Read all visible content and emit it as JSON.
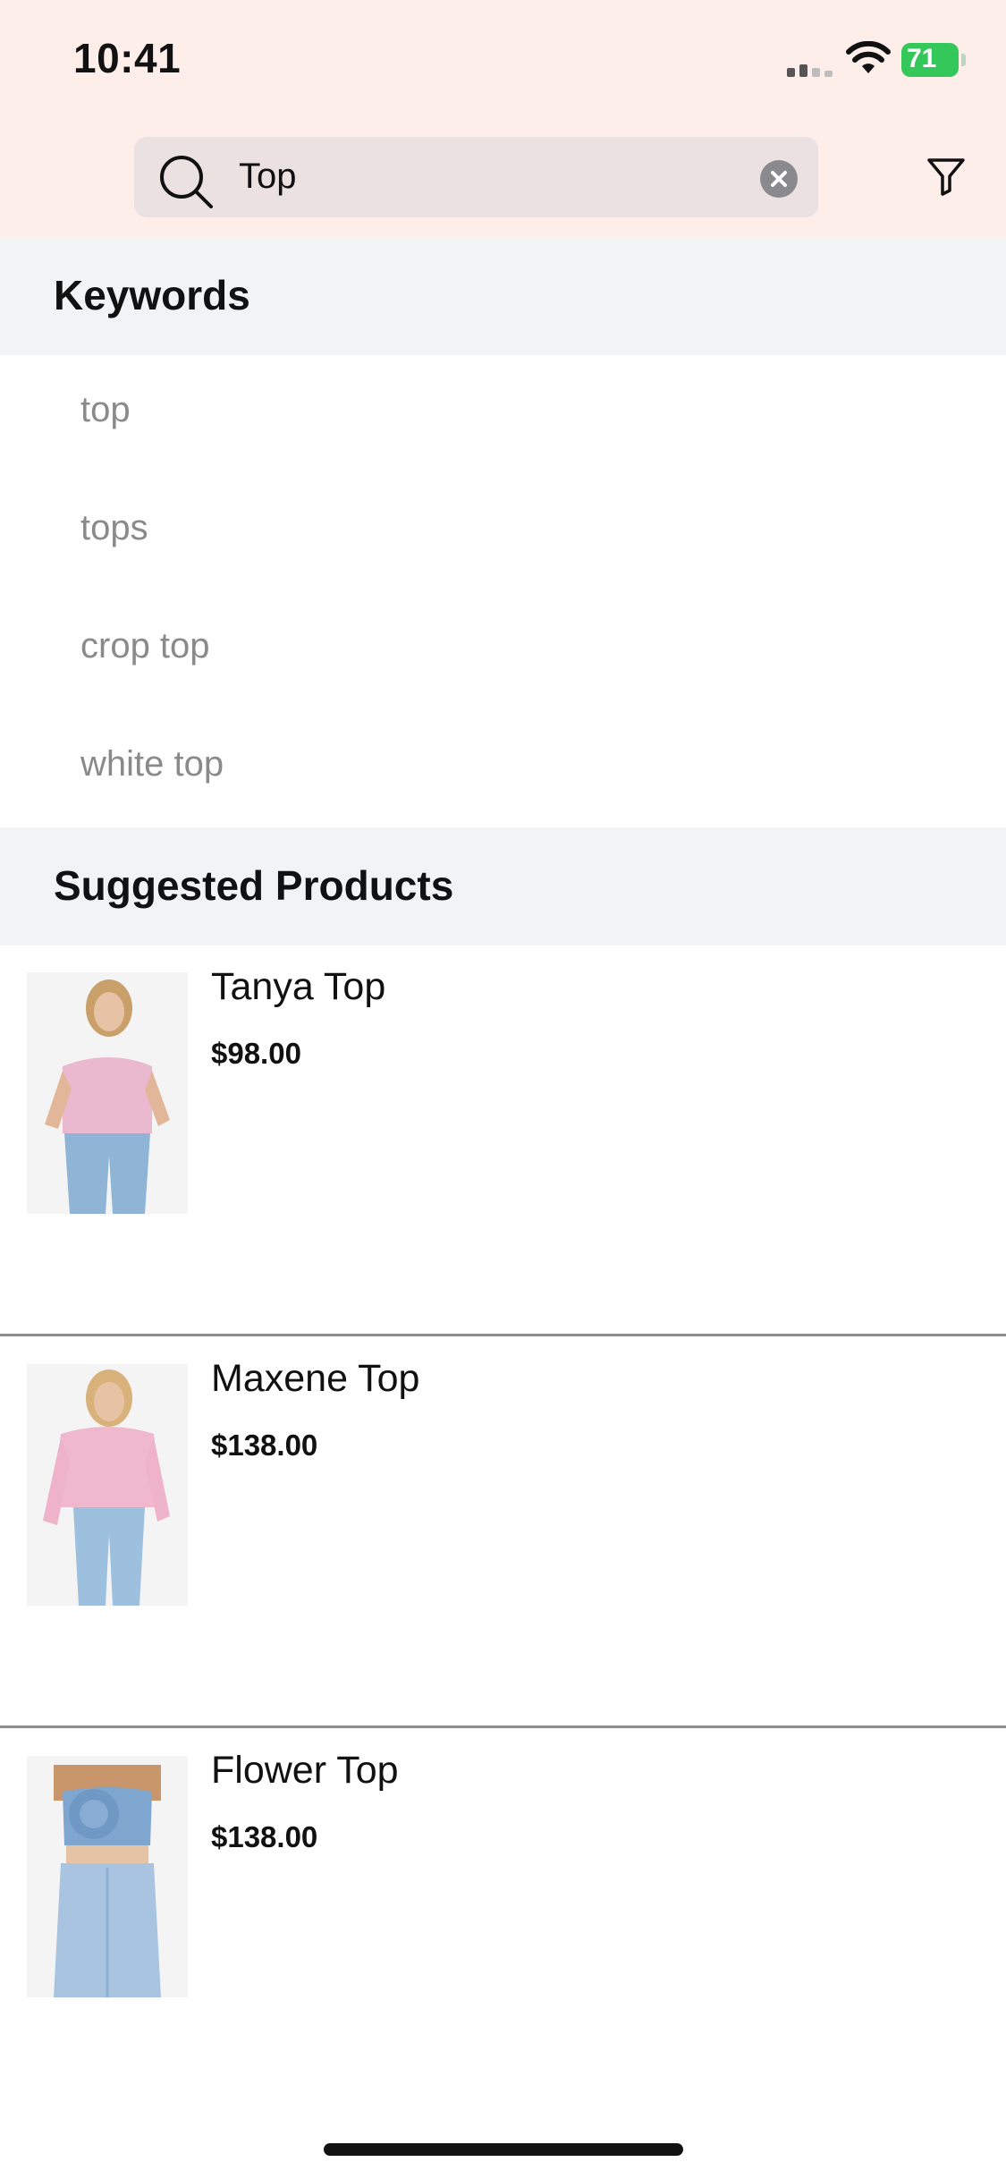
{
  "status_bar": {
    "time": "10:41",
    "battery_level": "71"
  },
  "search": {
    "query": "Top"
  },
  "keywords_section": {
    "title": "Keywords",
    "items": [
      "top",
      "tops",
      "crop top",
      "white top"
    ]
  },
  "products_section": {
    "title": "Suggested Products",
    "items": [
      {
        "name": "Tanya Top",
        "price": "$98.00"
      },
      {
        "name": "Maxene Top",
        "price": "$138.00"
      },
      {
        "name": "Flower Top",
        "price": "$138.00"
      }
    ]
  },
  "icons": {
    "search": "search-icon",
    "clear": "clear-icon",
    "filter": "filter-icon"
  },
  "colors": {
    "header_bg": "#fdeeea",
    "search_box_bg": "#ebe1e1",
    "section_bg": "#f2f3f5",
    "battery": "#34c759"
  }
}
